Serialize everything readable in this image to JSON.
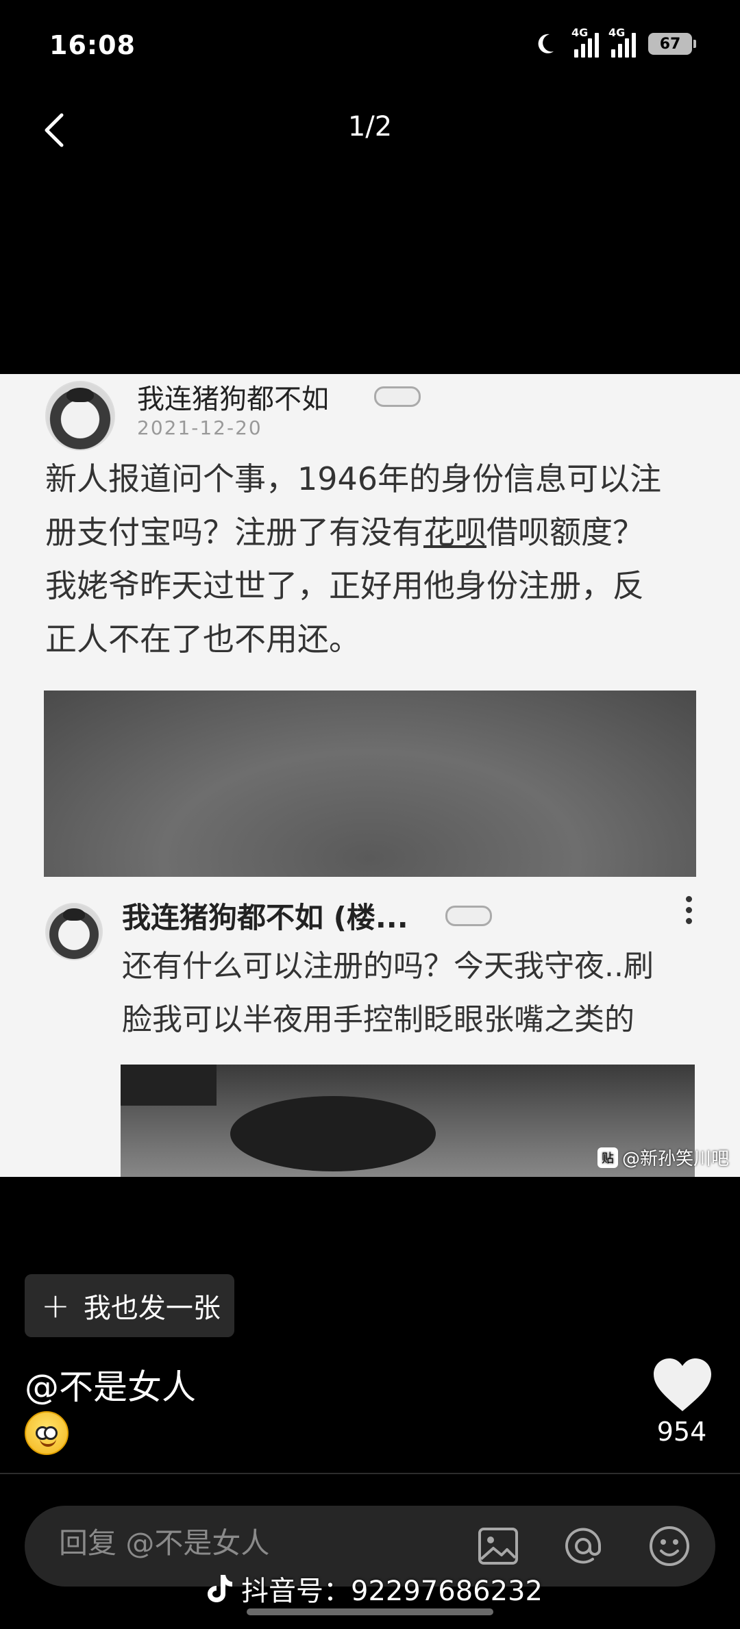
{
  "status": {
    "time": "16:08",
    "network_1": "4G",
    "network_2": "4G",
    "battery": "67"
  },
  "header": {
    "page_indicator": "1/2"
  },
  "post_image": {
    "main_post": {
      "username": "我连猪狗都不如",
      "date": "2021-12-20",
      "text_lines": [
        "新人报道问个事，1946年的身份信息可以注",
        "册支付宝吗？注册了有没有",
        "花呗",
        "借呗额度？",
        "我姥爷昨天过世了，正好用他身份注册，反",
        "正人不在了也不用还。"
      ]
    },
    "reply": {
      "username": "我连猪狗都不如 (楼...",
      "text_lines": [
        "还有什么可以注册的吗？今天我守夜..刷",
        "脸我可以半夜用手控制眨眼张嘴之类的"
      ]
    },
    "watermark": "@新孙笑川吧"
  },
  "actions": {
    "post_button_label": "我也发一张"
  },
  "author": {
    "mention": "@不是女人"
  },
  "likes": {
    "count": "954"
  },
  "reply_bar": {
    "placeholder": "回复 @不是女人"
  },
  "douyin": {
    "id_text": "抖音号：92297686232"
  },
  "icons": {
    "back": "chevron-left-icon",
    "like": "heart-icon",
    "image": "image-icon",
    "mention": "at-icon",
    "emoji": "smiley-icon",
    "more": "more-vertical-icon"
  },
  "colors": {
    "background": "#000000",
    "button_bg": "#2a2a2a",
    "reply_bar_bg": "#262626"
  }
}
